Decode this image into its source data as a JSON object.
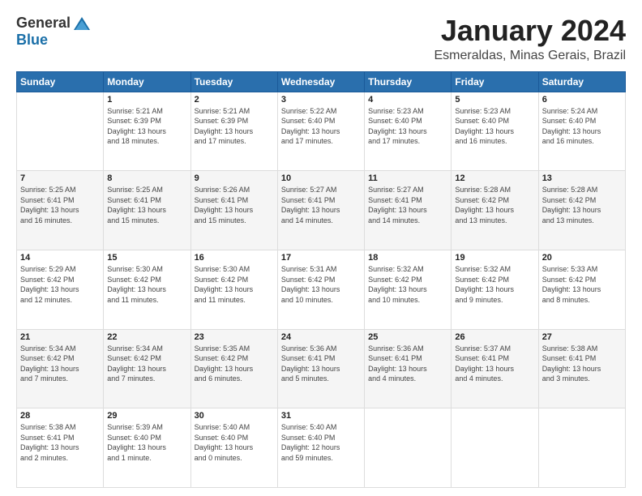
{
  "header": {
    "logo_general": "General",
    "logo_blue": "Blue",
    "month": "January 2024",
    "location": "Esmeraldas, Minas Gerais, Brazil"
  },
  "weekdays": [
    "Sunday",
    "Monday",
    "Tuesday",
    "Wednesday",
    "Thursday",
    "Friday",
    "Saturday"
  ],
  "weeks": [
    [
      {
        "day": "",
        "info": ""
      },
      {
        "day": "1",
        "info": "Sunrise: 5:21 AM\nSunset: 6:39 PM\nDaylight: 13 hours\nand 18 minutes."
      },
      {
        "day": "2",
        "info": "Sunrise: 5:21 AM\nSunset: 6:39 PM\nDaylight: 13 hours\nand 17 minutes."
      },
      {
        "day": "3",
        "info": "Sunrise: 5:22 AM\nSunset: 6:40 PM\nDaylight: 13 hours\nand 17 minutes."
      },
      {
        "day": "4",
        "info": "Sunrise: 5:23 AM\nSunset: 6:40 PM\nDaylight: 13 hours\nand 17 minutes."
      },
      {
        "day": "5",
        "info": "Sunrise: 5:23 AM\nSunset: 6:40 PM\nDaylight: 13 hours\nand 16 minutes."
      },
      {
        "day": "6",
        "info": "Sunrise: 5:24 AM\nSunset: 6:40 PM\nDaylight: 13 hours\nand 16 minutes."
      }
    ],
    [
      {
        "day": "7",
        "info": "Sunrise: 5:25 AM\nSunset: 6:41 PM\nDaylight: 13 hours\nand 16 minutes."
      },
      {
        "day": "8",
        "info": "Sunrise: 5:25 AM\nSunset: 6:41 PM\nDaylight: 13 hours\nand 15 minutes."
      },
      {
        "day": "9",
        "info": "Sunrise: 5:26 AM\nSunset: 6:41 PM\nDaylight: 13 hours\nand 15 minutes."
      },
      {
        "day": "10",
        "info": "Sunrise: 5:27 AM\nSunset: 6:41 PM\nDaylight: 13 hours\nand 14 minutes."
      },
      {
        "day": "11",
        "info": "Sunrise: 5:27 AM\nSunset: 6:41 PM\nDaylight: 13 hours\nand 14 minutes."
      },
      {
        "day": "12",
        "info": "Sunrise: 5:28 AM\nSunset: 6:42 PM\nDaylight: 13 hours\nand 13 minutes."
      },
      {
        "day": "13",
        "info": "Sunrise: 5:28 AM\nSunset: 6:42 PM\nDaylight: 13 hours\nand 13 minutes."
      }
    ],
    [
      {
        "day": "14",
        "info": "Sunrise: 5:29 AM\nSunset: 6:42 PM\nDaylight: 13 hours\nand 12 minutes."
      },
      {
        "day": "15",
        "info": "Sunrise: 5:30 AM\nSunset: 6:42 PM\nDaylight: 13 hours\nand 11 minutes."
      },
      {
        "day": "16",
        "info": "Sunrise: 5:30 AM\nSunset: 6:42 PM\nDaylight: 13 hours\nand 11 minutes."
      },
      {
        "day": "17",
        "info": "Sunrise: 5:31 AM\nSunset: 6:42 PM\nDaylight: 13 hours\nand 10 minutes."
      },
      {
        "day": "18",
        "info": "Sunrise: 5:32 AM\nSunset: 6:42 PM\nDaylight: 13 hours\nand 10 minutes."
      },
      {
        "day": "19",
        "info": "Sunrise: 5:32 AM\nSunset: 6:42 PM\nDaylight: 13 hours\nand 9 minutes."
      },
      {
        "day": "20",
        "info": "Sunrise: 5:33 AM\nSunset: 6:42 PM\nDaylight: 13 hours\nand 8 minutes."
      }
    ],
    [
      {
        "day": "21",
        "info": "Sunrise: 5:34 AM\nSunset: 6:42 PM\nDaylight: 13 hours\nand 7 minutes."
      },
      {
        "day": "22",
        "info": "Sunrise: 5:34 AM\nSunset: 6:42 PM\nDaylight: 13 hours\nand 7 minutes."
      },
      {
        "day": "23",
        "info": "Sunrise: 5:35 AM\nSunset: 6:42 PM\nDaylight: 13 hours\nand 6 minutes."
      },
      {
        "day": "24",
        "info": "Sunrise: 5:36 AM\nSunset: 6:41 PM\nDaylight: 13 hours\nand 5 minutes."
      },
      {
        "day": "25",
        "info": "Sunrise: 5:36 AM\nSunset: 6:41 PM\nDaylight: 13 hours\nand 4 minutes."
      },
      {
        "day": "26",
        "info": "Sunrise: 5:37 AM\nSunset: 6:41 PM\nDaylight: 13 hours\nand 4 minutes."
      },
      {
        "day": "27",
        "info": "Sunrise: 5:38 AM\nSunset: 6:41 PM\nDaylight: 13 hours\nand 3 minutes."
      }
    ],
    [
      {
        "day": "28",
        "info": "Sunrise: 5:38 AM\nSunset: 6:41 PM\nDaylight: 13 hours\nand 2 minutes."
      },
      {
        "day": "29",
        "info": "Sunrise: 5:39 AM\nSunset: 6:40 PM\nDaylight: 13 hours\nand 1 minute."
      },
      {
        "day": "30",
        "info": "Sunrise: 5:40 AM\nSunset: 6:40 PM\nDaylight: 13 hours\nand 0 minutes."
      },
      {
        "day": "31",
        "info": "Sunrise: 5:40 AM\nSunset: 6:40 PM\nDaylight: 12 hours\nand 59 minutes."
      },
      {
        "day": "",
        "info": ""
      },
      {
        "day": "",
        "info": ""
      },
      {
        "day": "",
        "info": ""
      }
    ]
  ]
}
